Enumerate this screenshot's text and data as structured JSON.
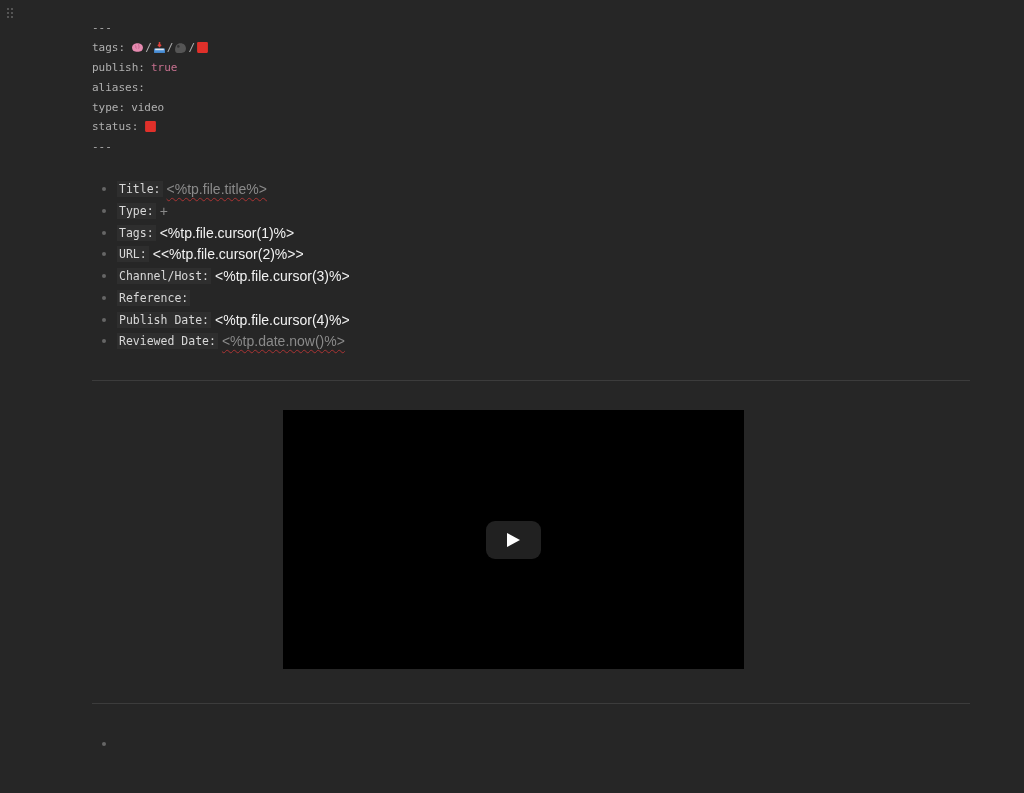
{
  "frontmatter": {
    "delimiter": "---",
    "tags_label": "tags:",
    "tag_separator": "/",
    "lines": [
      {
        "key": "publish:",
        "value": "true",
        "kind": "boolean"
      },
      {
        "key": "aliases:",
        "kind": "plain"
      },
      {
        "key": "type:",
        "value": "video",
        "kind": "plain"
      },
      {
        "key": "status:",
        "kind": "status"
      }
    ]
  },
  "fields": [
    {
      "label": "Title:",
      "value": "<%tp.file.title%>",
      "dimmed": true,
      "underlined": true
    },
    {
      "label": "Type:",
      "value": "+",
      "dimmed": true,
      "underlined": false
    },
    {
      "label": "Tags:",
      "value": "<%tp.file.cursor(1)%>",
      "dimmed": false,
      "underlined": false
    },
    {
      "label": "URL:",
      "value": "<<%tp.file.cursor(2)%>>",
      "dimmed": false,
      "underlined": false
    },
    {
      "label": "Channel/Host:",
      "value": "<%tp.file.cursor(3)%>",
      "dimmed": false,
      "underlined": false
    },
    {
      "label": "Reference:"
    },
    {
      "label": "Publish Date:",
      "value": "<%tp.file.cursor(4)%>",
      "dimmed": false,
      "underlined": false
    },
    {
      "label": "Reviewed Date:",
      "value": "<%tp.date.now()%>",
      "dimmed": true,
      "underlined": true
    }
  ],
  "trailing_bullet": true
}
